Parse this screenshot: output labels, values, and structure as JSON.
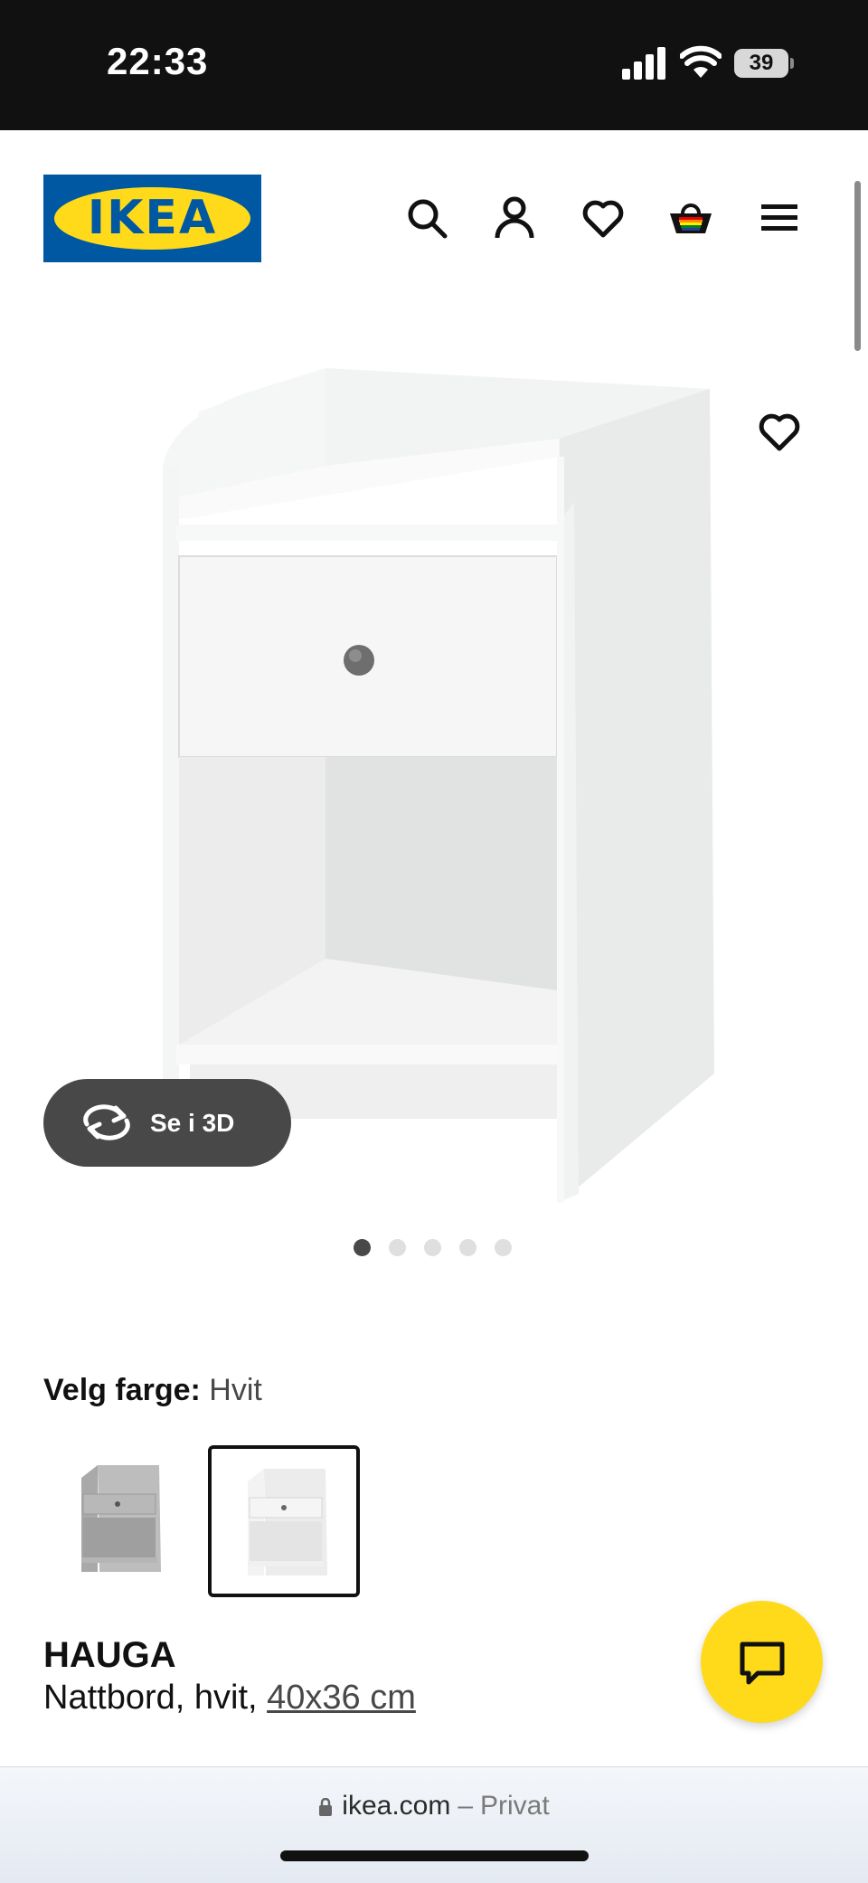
{
  "status_bar": {
    "time": "22:33",
    "battery": "39",
    "icons": [
      "signal-icon",
      "wifi-icon",
      "battery-icon"
    ]
  },
  "header": {
    "logo_text": "IKEA",
    "icons": [
      "search-icon",
      "account-icon",
      "heart-icon",
      "cart-icon",
      "menu-icon"
    ]
  },
  "gallery": {
    "view_3d_label": "Se i 3D",
    "slide_count": 5,
    "active_slide": 1
  },
  "color_select": {
    "label": "Velg farge:",
    "value": "Hvit",
    "options": [
      "grå",
      "hvit"
    ],
    "selected_index": 1
  },
  "product": {
    "name": "HAUGA",
    "description": "Nattbord, hvit,",
    "size": "40x36 cm"
  },
  "browser": {
    "domain": "ikea.com",
    "separator": "–",
    "mode": "Privat"
  },
  "colors": {
    "ikea_blue": "#0058a3",
    "ikea_yellow": "#ffda1a",
    "dark_gray": "#484848"
  }
}
